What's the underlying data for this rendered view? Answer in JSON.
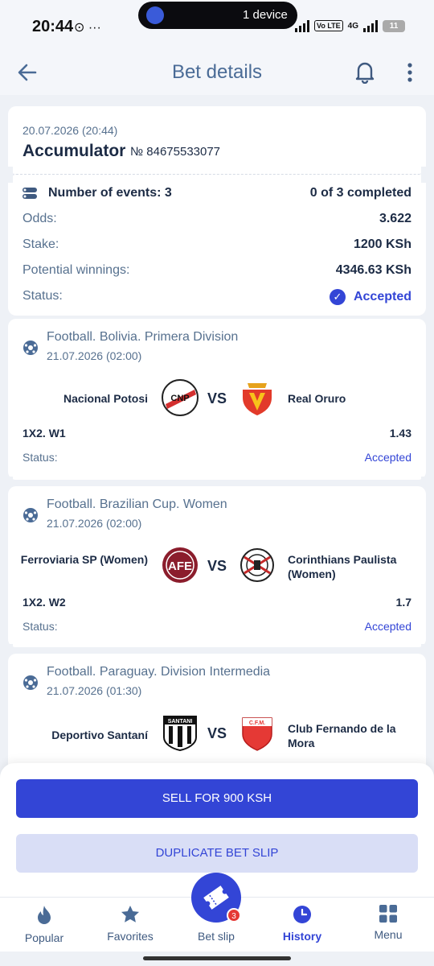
{
  "status_bar": {
    "time": "20:44",
    "dots": "⊙ ···",
    "device_pill": "1 device",
    "volte": "Vo LTE",
    "net": "4G",
    "battery": "11"
  },
  "header": {
    "title": "Bet details"
  },
  "bet": {
    "date": "20.07.2026 (20:44)",
    "type": "Accumulator",
    "number": "№ 84675533077",
    "events_label": "Number of events: 3",
    "completed": "0 of 3 completed",
    "odds_label": "Odds:",
    "odds_value": "3.622",
    "stake_label": "Stake:",
    "stake_value": "1200 KSh",
    "winnings_label": "Potential winnings:",
    "winnings_value": "4346.63 KSh",
    "status_label": "Status:",
    "status_value": "Accepted"
  },
  "events": [
    {
      "league": "Football. Bolivia. Primera Division",
      "date": "21.07.2026 (02:00)",
      "team1": "Nacional Potosi",
      "team2": "Real Oruro",
      "vs": "VS",
      "market": "1X2. W1",
      "coef": "1.43",
      "status_label": "Status:",
      "status_value": "Accepted"
    },
    {
      "league": "Football. Brazilian Cup. Women",
      "date": "21.07.2026 (02:00)",
      "team1": "Ferroviaria SP (Women)",
      "team2": "Corinthians Paulista (Women)",
      "vs": "VS",
      "market": "1X2. W2",
      "coef": "1.7",
      "status_label": "Status:",
      "status_value": "Accepted"
    },
    {
      "league": "Football. Paraguay. Division Intermedia",
      "date": "21.07.2026 (01:30)",
      "team1": "Deportivo Santaní",
      "team2": "Club Fernando de la Mora",
      "vs": "VS"
    }
  ],
  "logo_text": {
    "nacional": "CNP",
    "afe": "AFE",
    "santani": "SANTANI",
    "cfm": "C.F.M."
  },
  "actions": {
    "sell": "SELL FOR 900 KSH",
    "duplicate": "DUPLICATE BET SLIP"
  },
  "nav": {
    "popular": "Popular",
    "favorites": "Favorites",
    "betslip": "Bet slip",
    "betslip_badge": "3",
    "history": "History",
    "menu": "Menu"
  },
  "colors": {
    "accent": "#3345d6",
    "muted": "#57718f",
    "dark": "#1c2b45",
    "background": "#eef1f6"
  }
}
